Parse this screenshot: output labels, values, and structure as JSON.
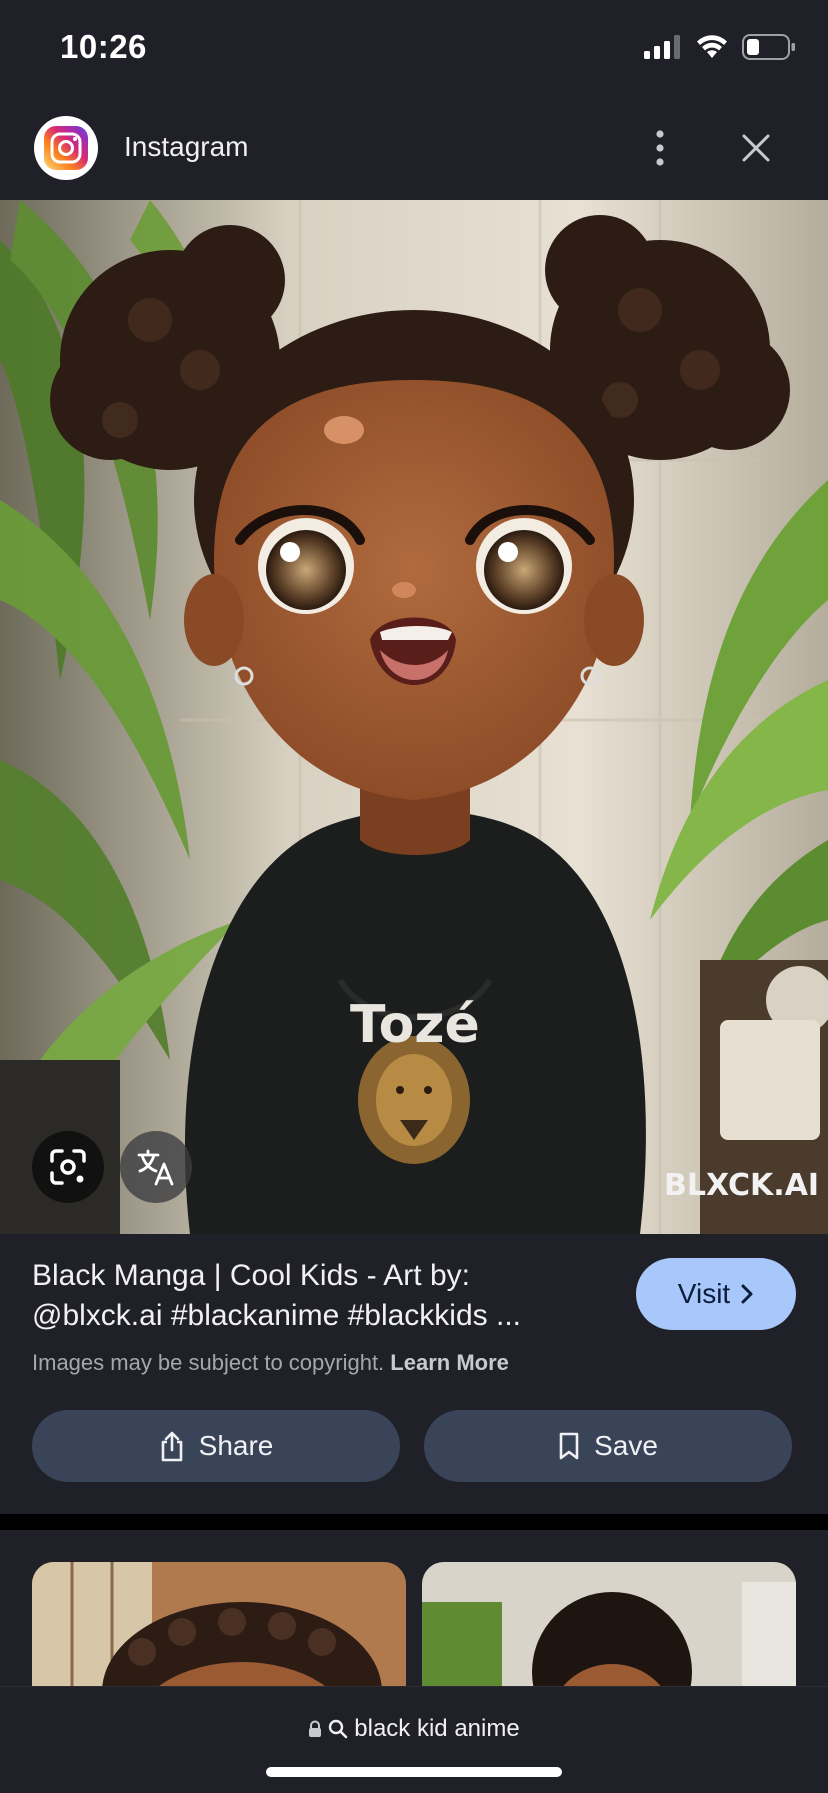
{
  "status_bar": {
    "time": "10:26"
  },
  "header": {
    "app_name": "Instagram"
  },
  "image": {
    "watermark": "BLXCK.AI",
    "shirt_text": "Tozé"
  },
  "result": {
    "title": "Black Manga | Cool Kids - Art by: @blxck.ai #blackanime #blackkids ...",
    "visit_label": "Visit",
    "copyright_text": "Images may be subject to copyright.",
    "learn_more": "Learn More"
  },
  "actions": {
    "share_label": "Share",
    "save_label": "Save"
  },
  "url_bar": {
    "query": "black kid anime"
  },
  "colors": {
    "background": "#1f2028",
    "accent": "#a8c7fa",
    "button": "#3a4458"
  }
}
